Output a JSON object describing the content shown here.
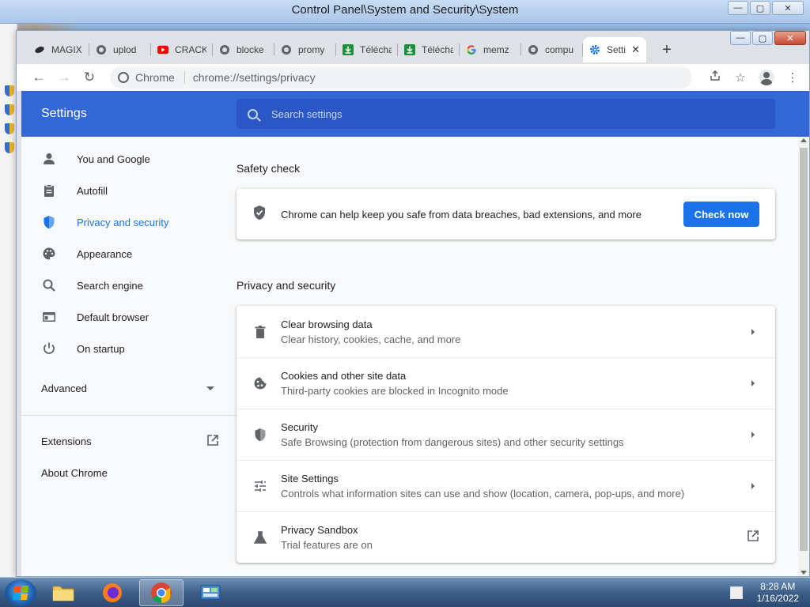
{
  "control_panel": {
    "title": "Control Panel\\System and Security\\System"
  },
  "chrome": {
    "tabs": [
      {
        "label": "MAGIX",
        "icon": "magix-icon",
        "color": "#3a3a3a"
      },
      {
        "label": "uplod",
        "icon": "globe-icon",
        "color": "#5f6368"
      },
      {
        "label": "CRACK",
        "icon": "youtube-icon",
        "color": "#ff0000"
      },
      {
        "label": "blocke",
        "icon": "globe-icon",
        "color": "#5f6368"
      },
      {
        "label": "promy",
        "icon": "globe-icon",
        "color": "#5f6368"
      },
      {
        "label": "Télécha",
        "icon": "download-icon",
        "color": "#1e8e3e"
      },
      {
        "label": "Télécha",
        "icon": "download-icon",
        "color": "#1e8e3e"
      },
      {
        "label": "memz",
        "icon": "google-icon",
        "color": "#4285f4"
      },
      {
        "label": "compu",
        "icon": "globe-icon",
        "color": "#5f6368"
      },
      {
        "label": "Setti",
        "icon": "gear-icon",
        "color": "#1a73e8",
        "active": true
      }
    ],
    "omnibox": {
      "site": "Chrome",
      "url": "chrome://settings/privacy"
    }
  },
  "settings": {
    "title": "Settings",
    "search_placeholder": "Search settings",
    "sidebar": {
      "items": [
        {
          "label": "You and Google",
          "icon": "person-icon"
        },
        {
          "label": "Autofill",
          "icon": "clipboard-icon"
        },
        {
          "label": "Privacy and security",
          "icon": "shield-icon",
          "active": true
        },
        {
          "label": "Appearance",
          "icon": "palette-icon"
        },
        {
          "label": "Search engine",
          "icon": "search-icon"
        },
        {
          "label": "Default browser",
          "icon": "browser-icon"
        },
        {
          "label": "On startup",
          "icon": "power-icon"
        }
      ],
      "advanced": "Advanced",
      "extensions": "Extensions",
      "about": "About Chrome"
    },
    "safety_check": {
      "heading": "Safety check",
      "text": "Chrome can help keep you safe from data breaches, bad extensions, and more",
      "button": "Check now"
    },
    "privacy": {
      "heading": "Privacy and security",
      "rows": [
        {
          "title": "Clear browsing data",
          "sub": "Clear history, cookies, cache, and more",
          "icon": "trash-icon"
        },
        {
          "title": "Cookies and other site data",
          "sub": "Third-party cookies are blocked in Incognito mode",
          "icon": "cookie-icon"
        },
        {
          "title": "Security",
          "sub": "Safe Browsing (protection from dangerous sites) and other security settings",
          "icon": "shield-icon"
        },
        {
          "title": "Site Settings",
          "sub": "Controls what information sites can use and show (location, camera, pop-ups, and more)",
          "icon": "sliders-icon"
        },
        {
          "title": "Privacy Sandbox",
          "sub": "Trial features are on",
          "icon": "flask-icon"
        }
      ]
    }
  },
  "taskbar": {
    "time": "8:28 AM",
    "date": "1/16/2022"
  },
  "colors": {
    "accent": "#1a73e8",
    "header": "#3367d6"
  }
}
